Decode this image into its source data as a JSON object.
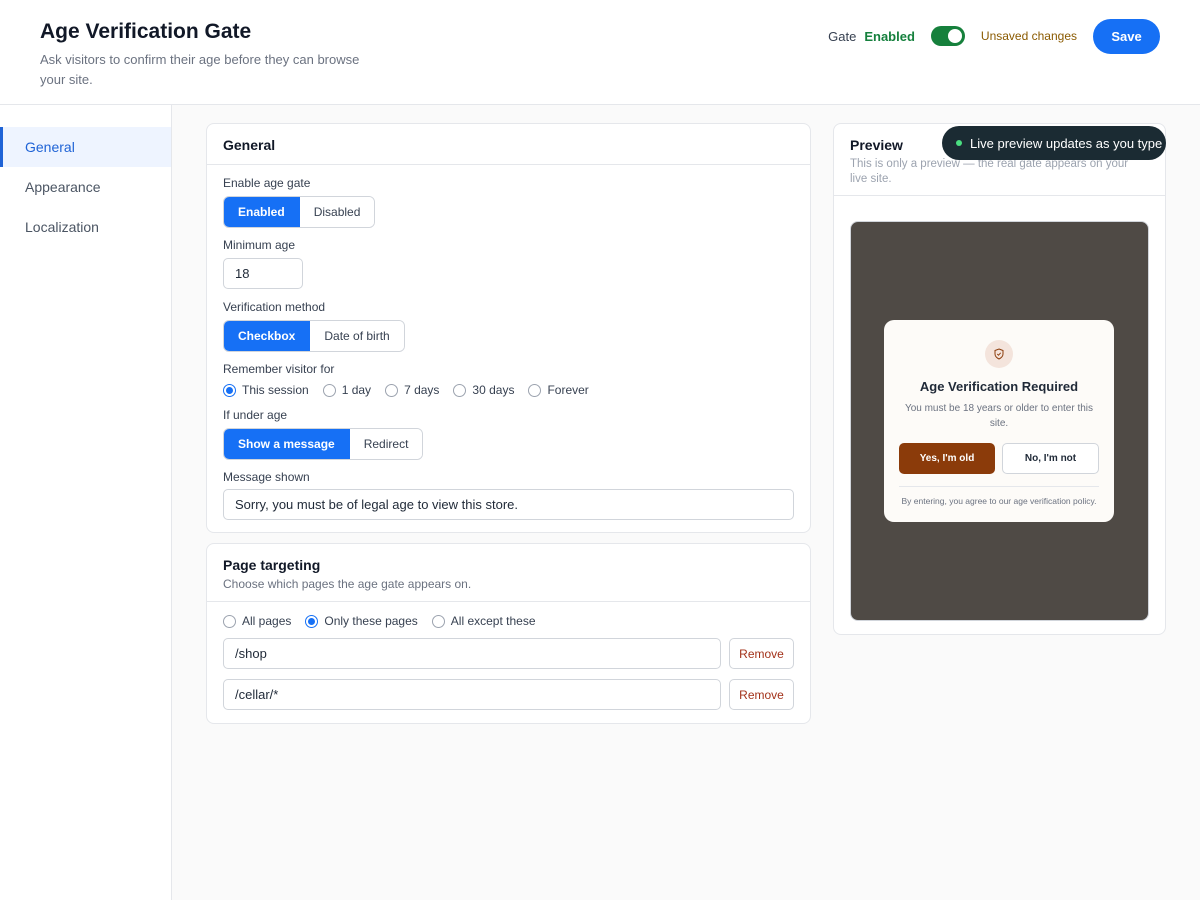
{
  "header": {
    "title": "Age Verification Gate",
    "subtitle": "Ask visitors to confirm their age before they can browse your site.",
    "gate_label": "Gate",
    "gate_status": "Enabled",
    "unsaved_text": "Unsaved changes",
    "save_label": "Save"
  },
  "sidebar": {
    "items": [
      {
        "label": "General",
        "active": true
      },
      {
        "label": "Appearance",
        "active": false
      },
      {
        "label": "Localization",
        "active": false
      }
    ]
  },
  "general": {
    "title": "General",
    "enable_label": "Enable age gate",
    "enable_options": [
      "Enabled",
      "Disabled"
    ],
    "enable_selected": "Enabled",
    "min_age_label": "Minimum age",
    "min_age_value": "18",
    "method_label": "Verification method",
    "method_options": [
      "Checkbox",
      "Date of birth"
    ],
    "method_selected": "Checkbox",
    "remember_label": "Remember visitor for",
    "remember_options": [
      "This session",
      "1 day",
      "7 days",
      "30 days",
      "Forever"
    ],
    "remember_selected": "This session",
    "under_age_label": "If under age",
    "under_age_options": [
      "Show a message",
      "Redirect"
    ],
    "under_age_selected": "Show a message",
    "message_label": "Message shown",
    "message_value": "Sorry, you must be of legal age to view this store."
  },
  "targeting": {
    "title": "Page targeting",
    "subtitle": "Choose which pages the age gate appears on.",
    "scope_options": [
      "All pages",
      "Only these pages",
      "All except these"
    ],
    "scope_selected": "Only these pages",
    "pages": [
      "/shop",
      "/cellar/*"
    ],
    "remove_label": "Remove"
  },
  "preview": {
    "title": "Preview",
    "subtitle": "This is only a preview — the real gate appears on your live site.",
    "tooltip": "Live preview updates as you type",
    "modal_title": "Age Verification Required",
    "modal_body": "You must be 18 years or older to enter this site.",
    "yes_label": "Yes, I'm old",
    "no_label": "No, I'm not",
    "footer": "By entering, you agree to our age verification policy."
  },
  "colors": {
    "accent": "#1670f5",
    "enabled_green": "#15803d",
    "yes_button": "#8b3b0a",
    "preview_backdrop": "#4f4a45"
  }
}
